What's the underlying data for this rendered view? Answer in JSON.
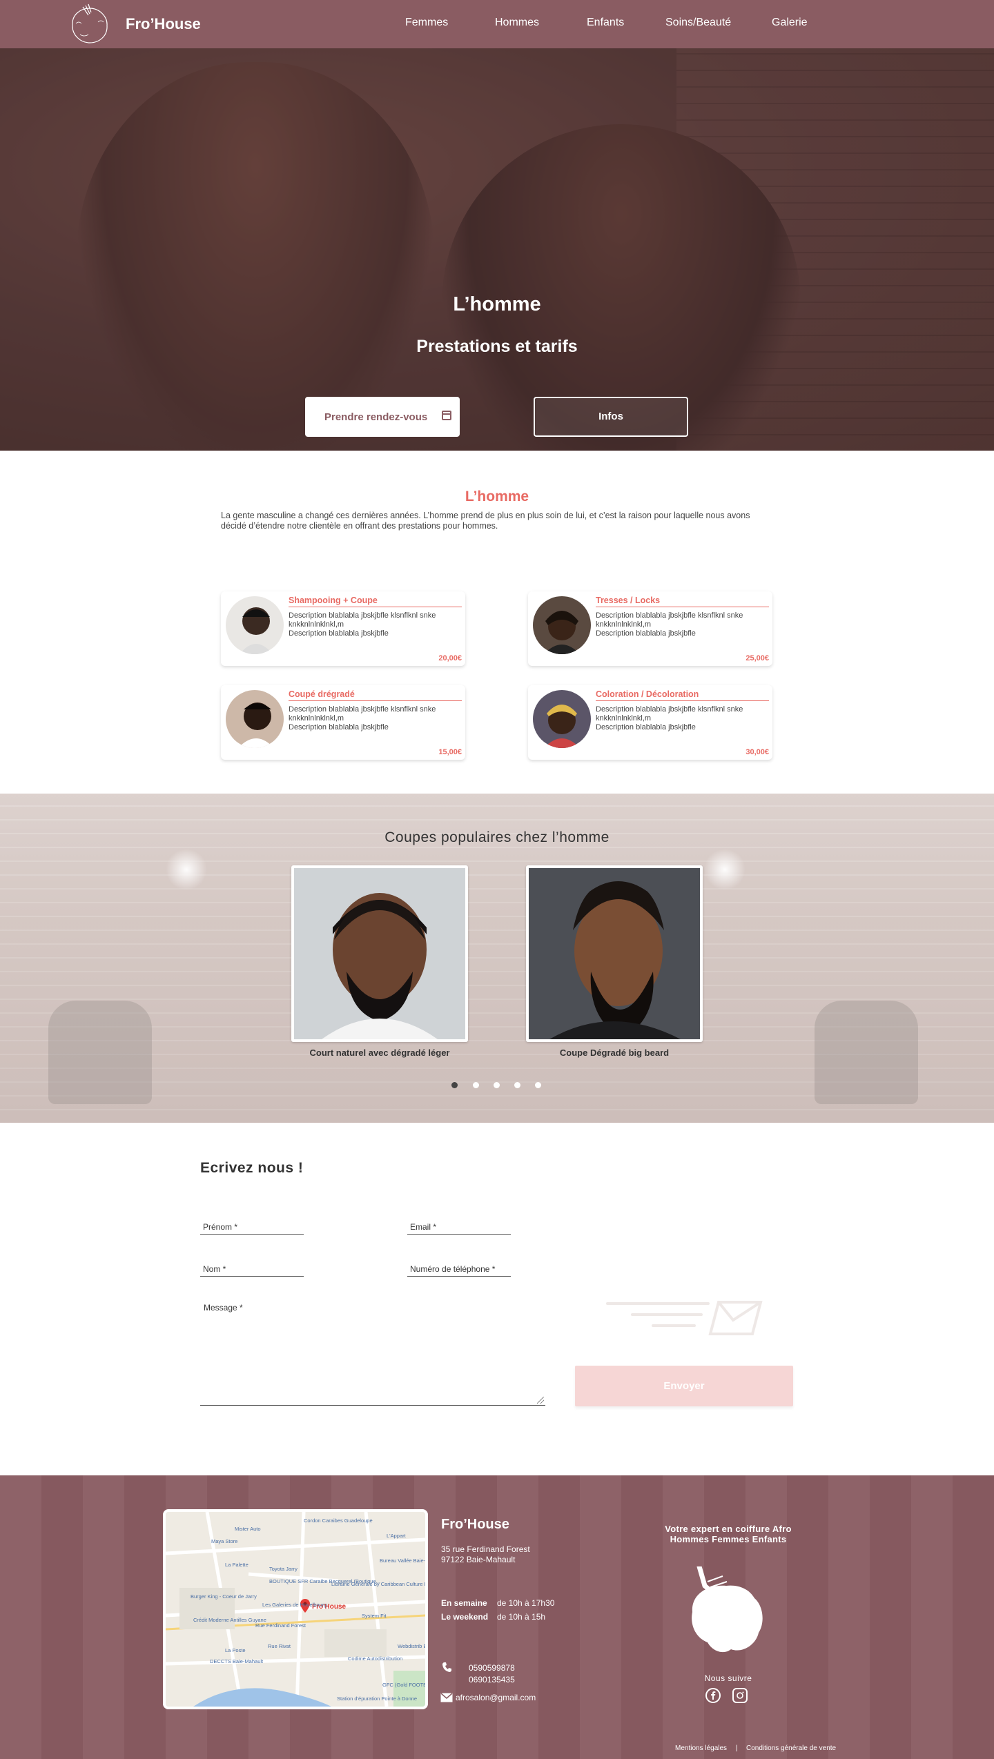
{
  "header": {
    "brand": "Fro’House",
    "nav": [
      "Femmes",
      "Hommes",
      "Enfants",
      "Soins/Beauté",
      "Galerie"
    ]
  },
  "hero": {
    "title": "L’homme",
    "subtitle": "Prestations et tarifs",
    "rdv_label": "Prendre rendez-vous",
    "infos_label": "Infos"
  },
  "intro": {
    "title": "L’homme",
    "text": "La gente masculine a changé ces dernières années. L’homme prend de plus en plus soin de lui, et c’est la raison pour laquelle nous avons décidé d’étendre notre clientèle en offrant des prestations pour hommes."
  },
  "services": [
    {
      "title": "Shampooing + Coupe",
      "desc": "Description blablabla jbskjbfle klsnflknl snke knkknlnlnklnkl,m\nDescription blablabla jbskjbfle",
      "price": "20,00€"
    },
    {
      "title": "Tresses / Locks",
      "desc": "Description blablabla jbskjbfle klsnflknl snke knkknlnlnklnkl,m\nDescription blablabla jbskjbfle",
      "price": "25,00€"
    },
    {
      "title": "Coupé drégradé",
      "desc": "Description blablabla jbskjbfle klsnflknl snke knkknlnlnklnkl,m\nDescription blablabla jbskjbfle",
      "price": "15,00€"
    },
    {
      "title": "Coloration / Décoloration",
      "desc": "Description blablabla jbskjbfle klsnflknl snke knkknlnlnklnkl,m\nDescription blablabla jbskjbfle",
      "price": "30,00€"
    }
  ],
  "popular": {
    "title": "Coupes populaires chez l’homme",
    "items": [
      {
        "caption": "Court naturel avec dégradé léger"
      },
      {
        "caption": "Coupe Dégradé big beard"
      }
    ],
    "active_slide": 1,
    "slide_count": 5
  },
  "contact": {
    "title": "Ecrivez nous !",
    "firstname_placeholder": "Prénom *",
    "email_placeholder": "Email *",
    "lastname_placeholder": "Nom *",
    "phone_placeholder": "Numéro de téléphone *",
    "message_placeholder": "Message *",
    "send_label": "Envoyer"
  },
  "footer": {
    "brand": "Fro’House",
    "address_line1": "35 rue Ferdinand Forest",
    "address_line2": "97122 Baie-Mahault",
    "hours": [
      {
        "label": "En semaine",
        "value": "de 10h à 17h30"
      },
      {
        "label": "Le weekend",
        "value": "de 10h à 15h"
      }
    ],
    "phone1": "0590599878",
    "phone2": "0690135435",
    "email": "afrosalon@gmail.com",
    "tagline_line1": "Votre expert en coiffure Afro",
    "tagline_line2": "Hommes Femmes Enfants",
    "follow": "Nous suivre",
    "legal": "Mentions légales",
    "separator": "|",
    "cgv": "Conditions générale de vente"
  },
  "map": {
    "pin_label": "Fro'House",
    "places": [
      "Cordon Caraibes Guadeloupe",
      "Mister Auto",
      "Maya Store",
      "L'Appart",
      "La Palette",
      "Bureau Vallée Baie-Mahault",
      "Toyota Jarry",
      "BOUTIQUE SFR Caraibe Becquerel (Boutique...",
      "Librairie Générale by Caribbean Culture House",
      "Burger King - Coeur de Jarry",
      "Les Galeries de Houelbourg",
      "System Fit",
      "Crédit Moderne Antilles Guyane",
      "La Poste",
      "Codime Autodistribution",
      "Webdistrib Baie-Mahau",
      "DECCTS Baie-Mahault",
      "GFC (Gold FOOTBALL CL",
      "Station d'épuration Pointe à Donne",
      "Rue Rivat",
      "Rue Ferdinand Forest"
    ]
  },
  "colors": {
    "header_bg": "#8a5c62",
    "accent": "#e86a63",
    "send_button": "#f6d6d5",
    "footer_bg": "#8a5c62"
  },
  "icons": [
    "logo-mark",
    "calendar-icon",
    "phone-icon",
    "mail-icon",
    "facebook-icon",
    "instagram-icon",
    "map-pin-icon",
    "afro-head-logo"
  ]
}
